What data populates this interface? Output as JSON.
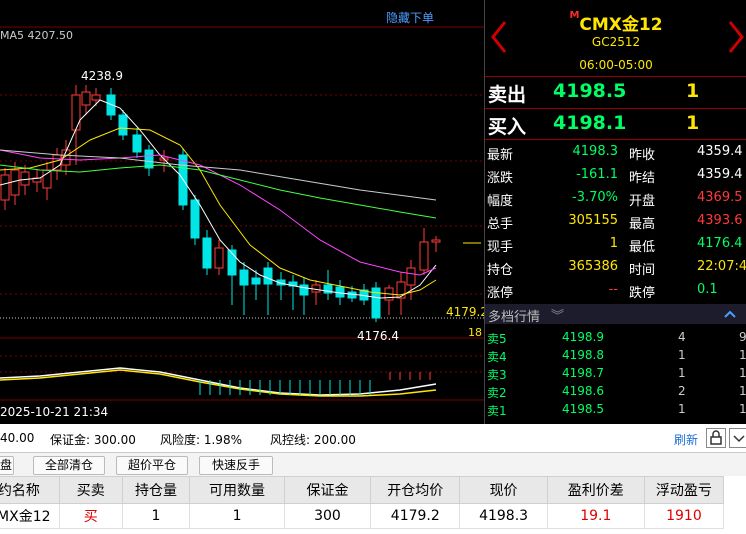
{
  "chart": {
    "hide_order_label": "隐藏下单",
    "ma_label": "MA5 4207.50",
    "high_label": "4238.9",
    "low_label": "4176.4",
    "right_price_label": "4179.2",
    "right_vol_label": "18",
    "datetime_label": "2025-10-21 21:34",
    "colors": {
      "up": "#ff3a3a",
      "down": "#00e6e6",
      "ma5": "#ffffff",
      "ma10": "#ffe600",
      "ma20": "#ff44ff",
      "ma60": "#44ff44",
      "ma30": "#cccccc"
    }
  },
  "quote": {
    "symbol_prefix": "M",
    "symbol": "CMX金12",
    "code": "GC2512",
    "session": "06:00-05:00",
    "sell_label": "卖出",
    "sell_price": "4198.5",
    "sell_qty": "1",
    "buy_label": "买入",
    "buy_price": "4198.1",
    "buy_qty": "1",
    "rows": [
      {
        "l1": "最新",
        "v1": "4198.3",
        "c1": "#00ff66",
        "l2": "昨收",
        "v2": "4359.4",
        "c2": "#ffffff"
      },
      {
        "l1": "涨跌",
        "v1": "-161.1",
        "c1": "#00ff66",
        "l2": "昨结",
        "v2": "4359.4",
        "c2": "#ffffff"
      },
      {
        "l1": "幅度",
        "v1": "-3.70%",
        "c1": "#00ff66",
        "l2": "开盘",
        "v2": "4369.5",
        "c2": "#ff3a3a"
      },
      {
        "l1": "总手",
        "v1": "305155",
        "c1": "#ffe600",
        "l2": "最高",
        "v2": "4393.6",
        "c2": "#ff3a3a"
      },
      {
        "l1": "现手",
        "v1": "1",
        "c1": "#ffe600",
        "l2": "最低",
        "v2": "4176.4",
        "c2": "#00ff66"
      },
      {
        "l1": "持仓",
        "v1": "365386",
        "c1": "#ffe600",
        "l2": "时间",
        "v2": "22:07:42",
        "c2": "#ffe600"
      },
      {
        "l1": "涨停",
        "v1": "--",
        "c1": "#ff3a3a",
        "l2": "跌停",
        "v2": "0.1",
        "c2": "#00ff66"
      }
    ],
    "depth_label": "多档行情",
    "depth": [
      {
        "name": "卖5",
        "price": "4198.9",
        "qty": "4",
        "extra": "9"
      },
      {
        "name": "卖4",
        "price": "4198.8",
        "qty": "1",
        "extra": "1"
      },
      {
        "name": "卖3",
        "price": "4198.7",
        "qty": "1",
        "extra": "1"
      },
      {
        "name": "卖2",
        "price": "4198.6",
        "qty": "2",
        "extra": "1"
      },
      {
        "name": "卖1",
        "price": "4198.5",
        "qty": "1",
        "extra": "1"
      }
    ]
  },
  "account": {
    "balance": "40.00",
    "margin": "保证金: 300.00",
    "risk": "风险度: 1.98%",
    "control": "风控线: 200.00",
    "refresh": "刷新"
  },
  "buttons": {
    "first": "盘",
    "close_all": "全部清仓",
    "over_close": "超价平仓",
    "reverse": "快速反手"
  },
  "positions": {
    "headers": [
      "约名称",
      "买卖",
      "持仓量",
      "可用数量",
      "保证金",
      "开仓均价",
      "现价",
      "盈利价差",
      "浮动盈亏"
    ],
    "row": [
      "CMX金12",
      "买",
      "1",
      "1",
      "300",
      "4179.2",
      "4198.3",
      "19.1",
      "1910"
    ]
  }
}
